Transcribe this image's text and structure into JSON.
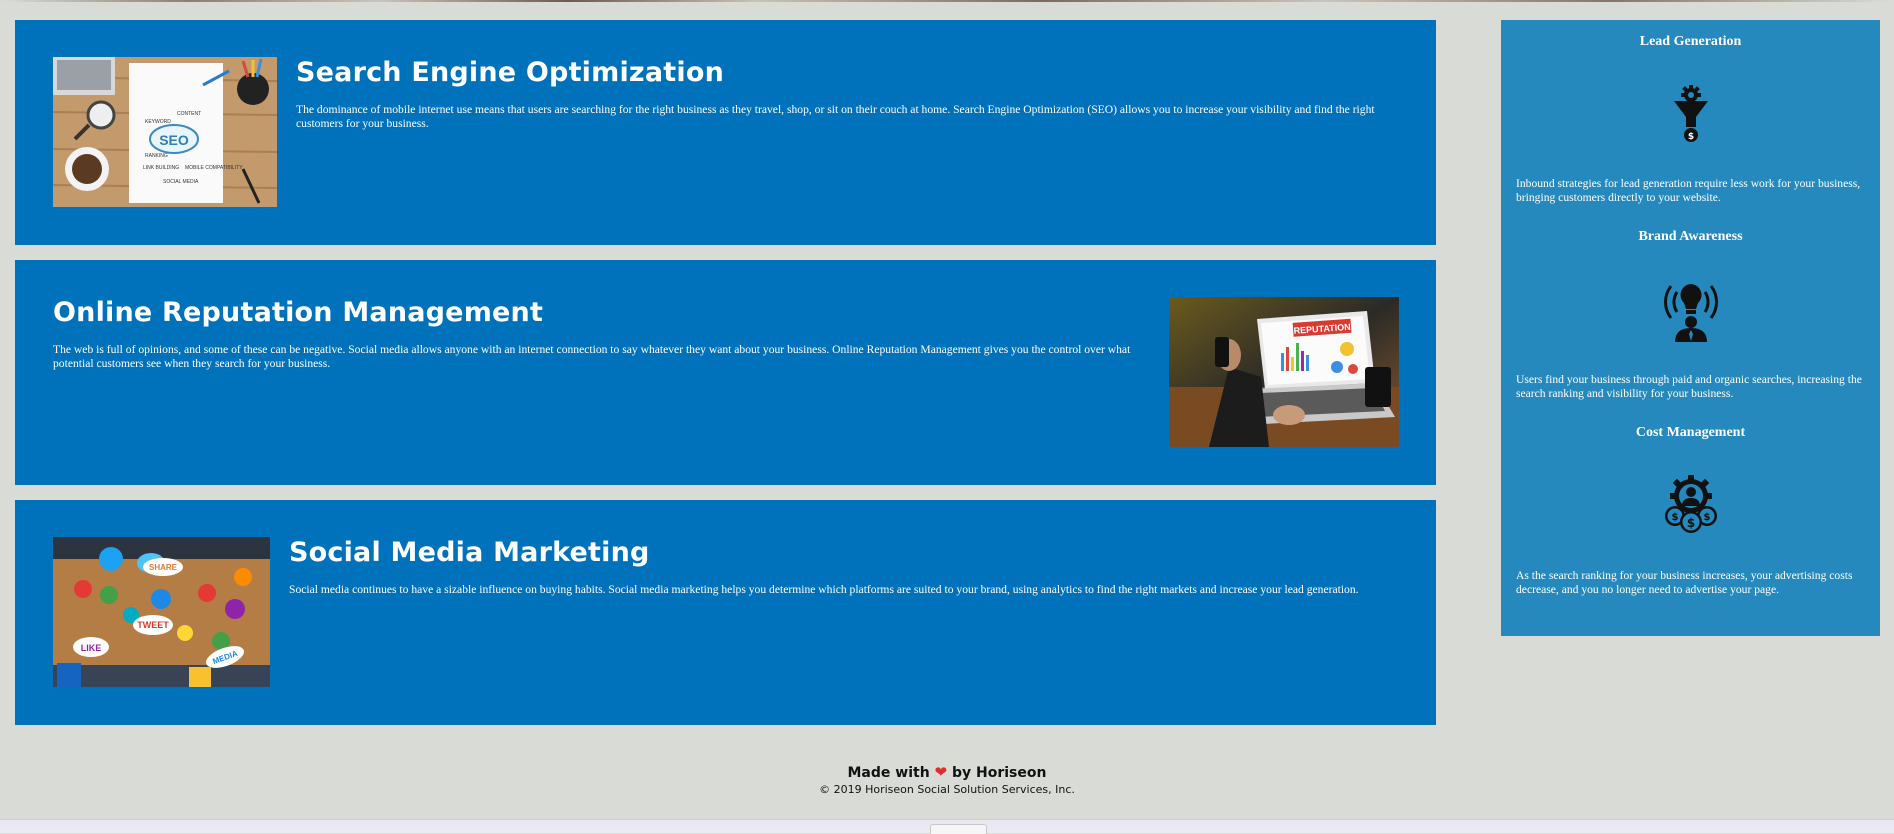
{
  "services": [
    {
      "title": "Search Engine Optimization",
      "text": "The dominance of mobile internet use means that users are searching for the right business as they travel, shop, or sit on their couch at home. Search Engine Optimization (SEO) allows you to increase your visibility and find the right customers for your business.",
      "image_label": "SEO",
      "image_words": [
        "CONTENT",
        "KEYWORD",
        "RANKING",
        "LINK BUILDING",
        "MOBILE COMPATIBILITY",
        "SOCIAL MEDIA"
      ]
    },
    {
      "title": "Online Reputation Management",
      "text": "The web is full of opinions, and some of these can be negative. Social media allows anyone with an internet connection to say whatever they want about your business. Online Reputation Management gives you the control over what potential customers see when they search for your business.",
      "image_label": "REPUTATION"
    },
    {
      "title": "Social Media Marketing",
      "text": "Social media continues to have a sizable influence on buying habits. Social media marketing helps you determine which platforms are suited to your brand, using analytics to find the right markets and increase your lead generation.",
      "image_words": [
        "SHARE",
        "TWEET",
        "LIKE",
        "MEDIA"
      ]
    }
  ],
  "benefits": [
    {
      "title": "Lead Generation",
      "icon": "lead-generation-icon",
      "text": "Inbound strategies for lead generation require less work for your business, bringing customers directly to your website."
    },
    {
      "title": "Brand Awareness",
      "icon": "brand-awareness-icon",
      "text": "Users find your business through paid and organic searches, increasing the search ranking and visibility for your business."
    },
    {
      "title": "Cost Management",
      "icon": "cost-management-icon",
      "text": "As the search ranking for your business increases, your advertising costs decrease, and you no longer need to advertise your page."
    }
  ],
  "footer": {
    "made_with": "Made with",
    "heart": "❤",
    "by": "by Horiseon",
    "copyright": "© 2019 Horiseon Social Solution Services, Inc."
  },
  "colors": {
    "card": "#0072bb",
    "aside": "#2589bd",
    "page": "#d9dcd6",
    "heart": "#e32b2b"
  }
}
